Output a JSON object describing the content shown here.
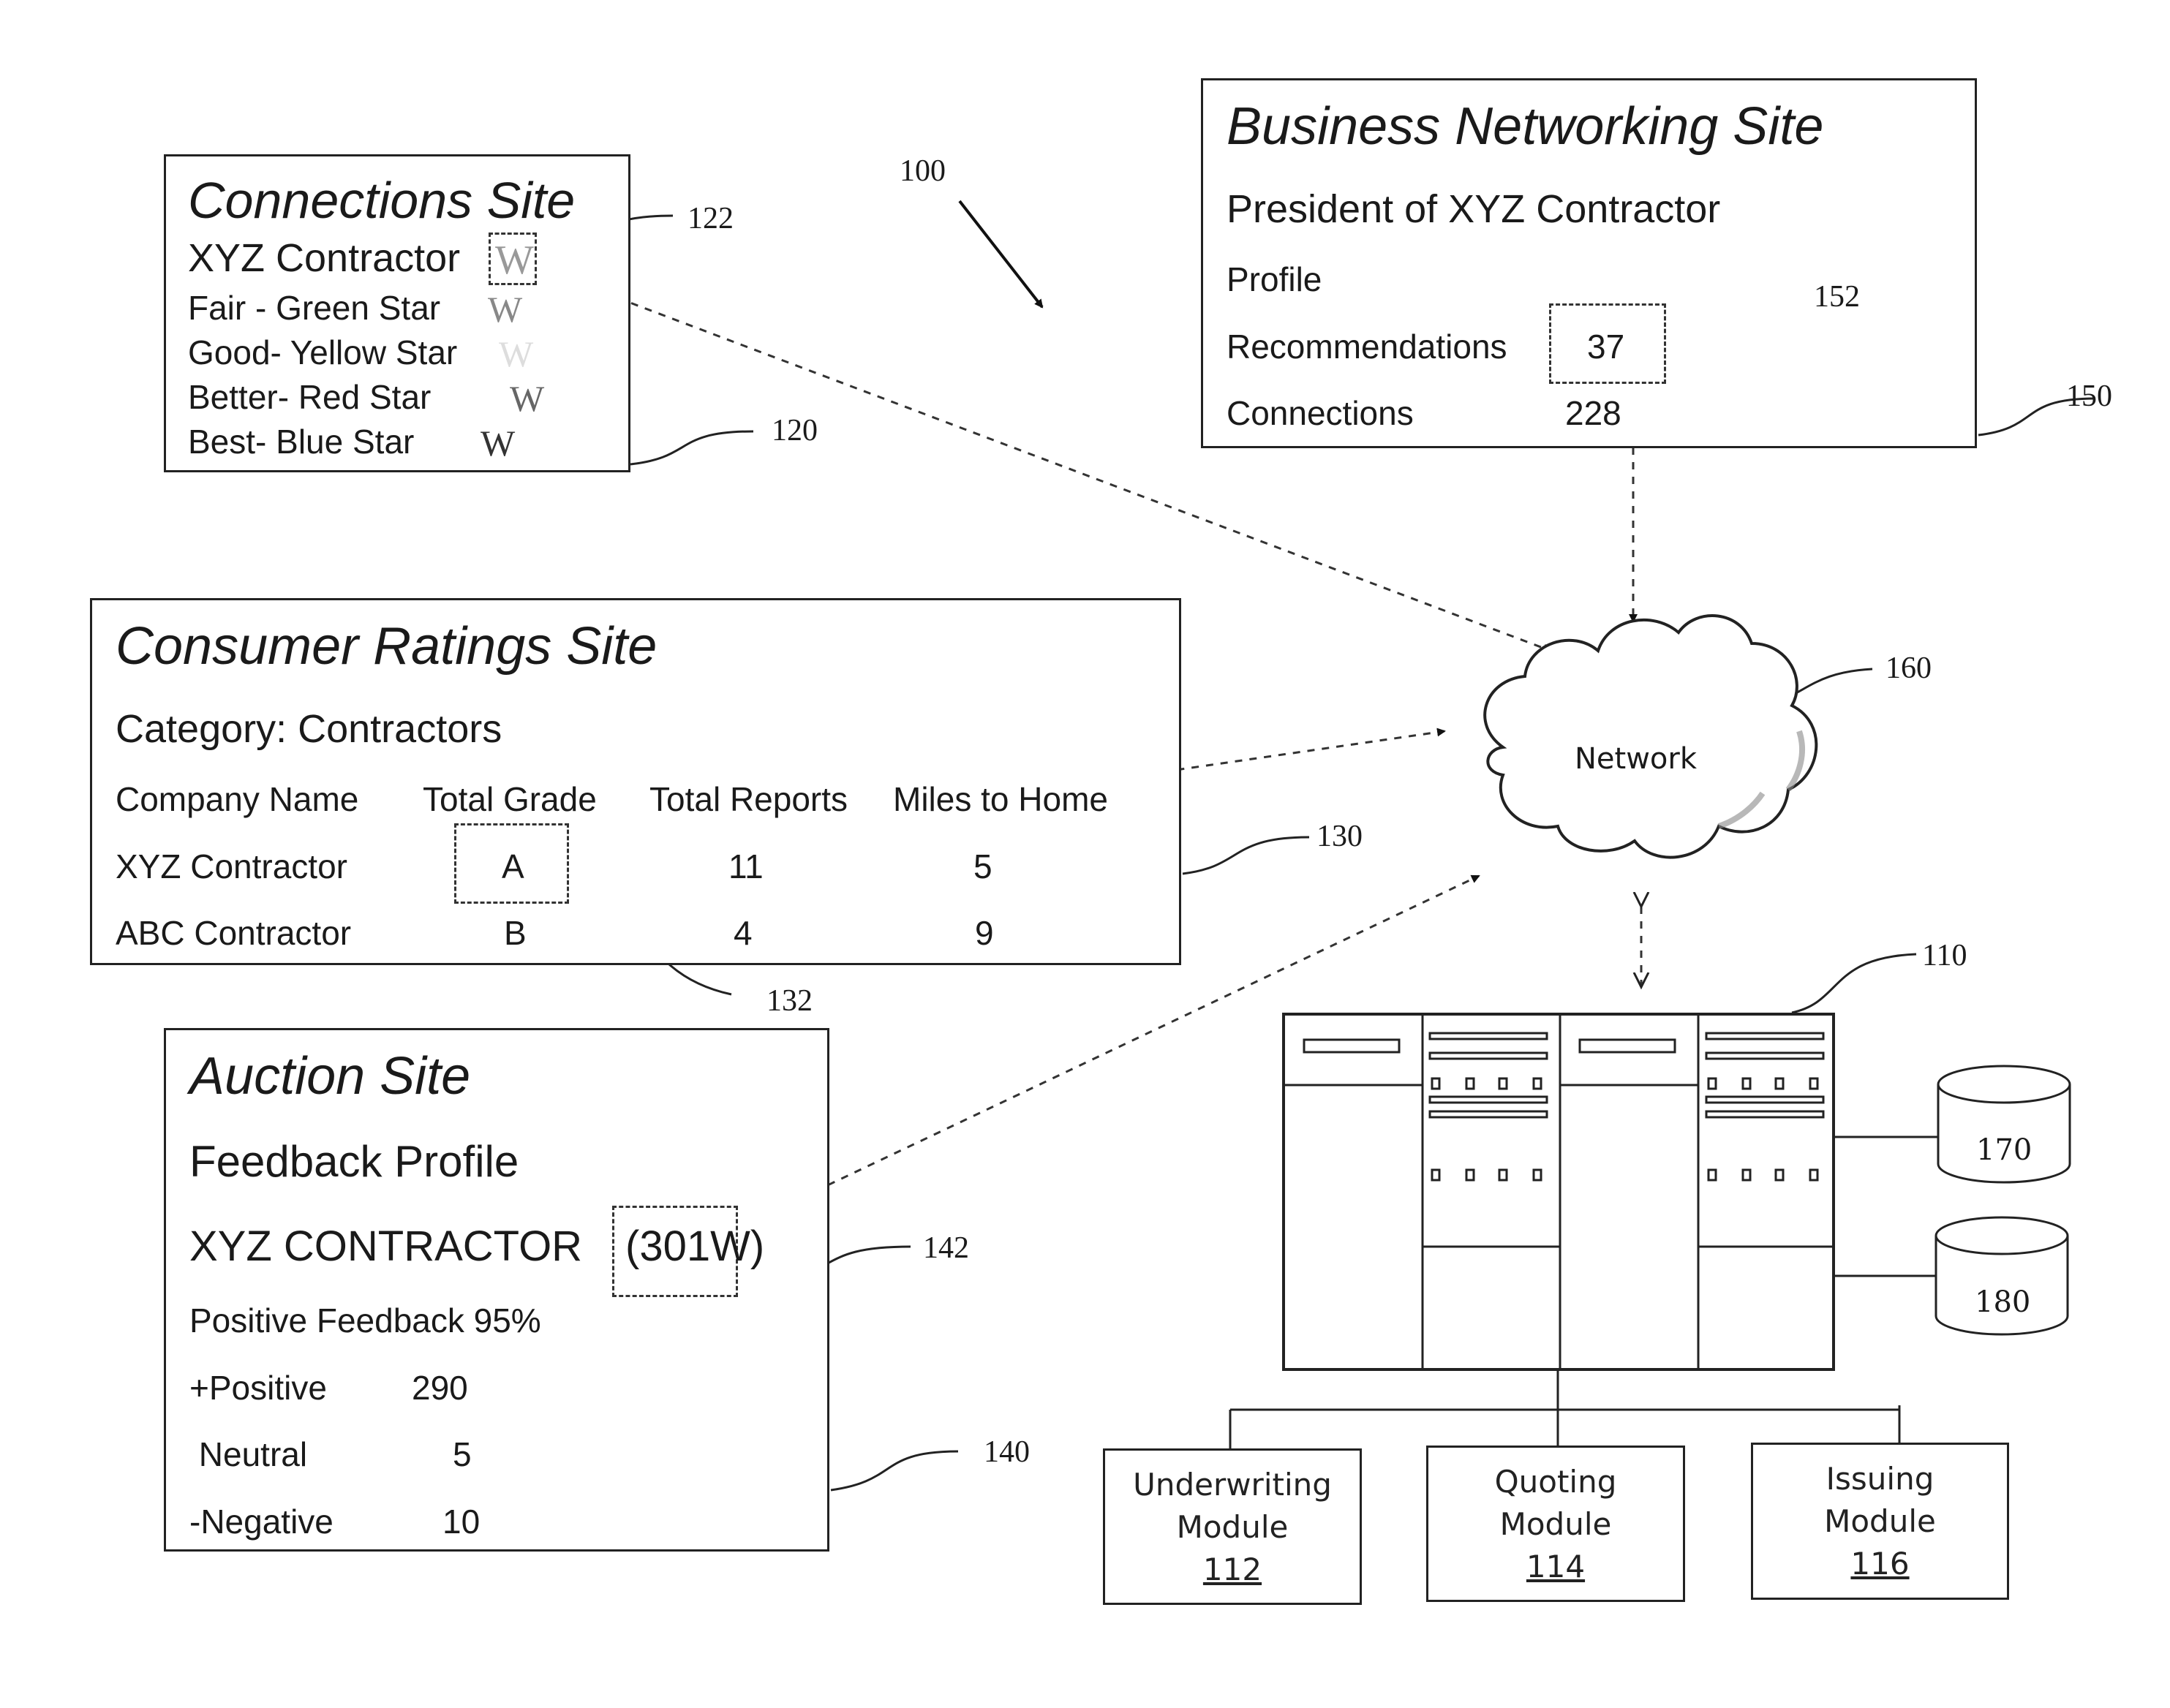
{
  "figure_ref": "100",
  "connections_site": {
    "title": "Connections Site",
    "ref": "120",
    "badge_ref": "122",
    "entity": "XYZ Contractor",
    "entity_badge": "W",
    "legend": [
      {
        "label": "Fair - Green Star",
        "badge": "W"
      },
      {
        "label": "Good- Yellow Star",
        "badge": "W"
      },
      {
        "label": "Better- Red Star",
        "badge": "W"
      },
      {
        "label": "Best-  Blue Star",
        "badge": "W"
      }
    ]
  },
  "business_site": {
    "title": "Business Networking Site",
    "ref": "150",
    "highlight_ref": "152",
    "subtitle": "President of XYZ Contractor",
    "profile_label": "Profile",
    "rows": [
      {
        "label": "Recommendations",
        "value": "37"
      },
      {
        "label": "Connections",
        "value": "228"
      }
    ]
  },
  "consumer_site": {
    "title": "Consumer Ratings Site",
    "ref": "130",
    "highlight_ref": "132",
    "category": "Category:  Contractors",
    "columns": [
      "Company Name",
      "Total Grade",
      "Total Reports",
      "Miles to Home"
    ],
    "rows": [
      [
        "XYZ  Contractor",
        "A",
        "11",
        "5"
      ],
      [
        "ABC Contractor",
        "B",
        "4",
        "9"
      ]
    ]
  },
  "auction_site": {
    "title": "Auction Site",
    "ref": "140",
    "highlight_ref": "142",
    "subtitle": "Feedback Profile",
    "entity": "XYZ CONTRACTOR",
    "entity_score": "(301W)",
    "positive_feedback": "Positive Feedback 95%",
    "rows": [
      {
        "label": "+Positive",
        "value": "290"
      },
      {
        "label": " Neutral",
        "value": "5"
      },
      {
        "label": "-Negative",
        "value": "10"
      }
    ]
  },
  "network": {
    "label": "Network",
    "ref": "160"
  },
  "server": {
    "ref": "110"
  },
  "databases": [
    {
      "ref": "170"
    },
    {
      "ref": "180"
    }
  ],
  "modules": [
    {
      "line1": "Underwriting",
      "line2": "Module",
      "num": "112"
    },
    {
      "line1": "Quoting",
      "line2": "Module",
      "num": "114"
    },
    {
      "line1": "Issuing",
      "line2": "Module",
      "num": "116"
    }
  ]
}
